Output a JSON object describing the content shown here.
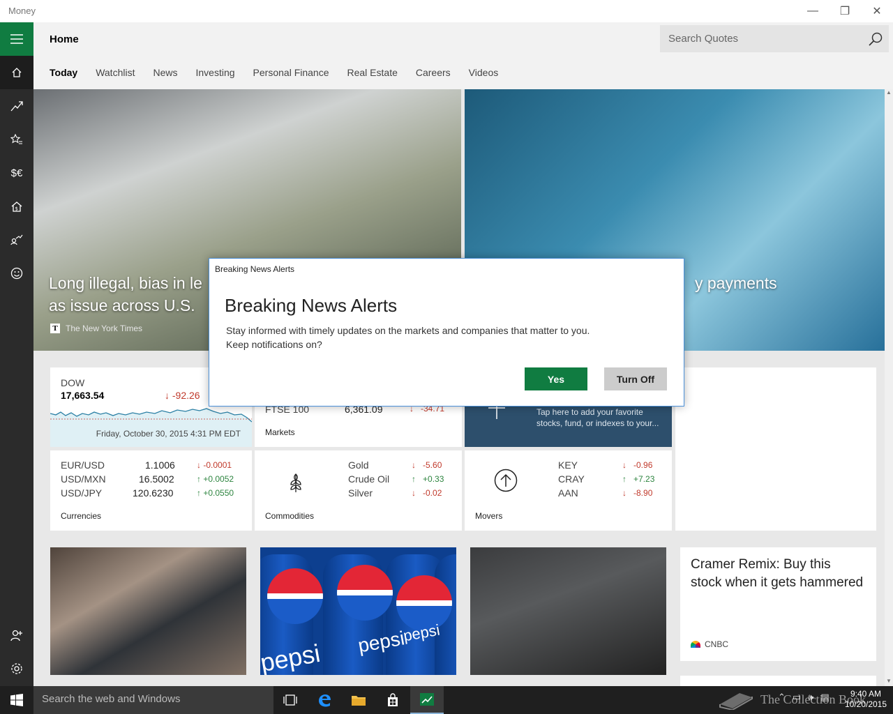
{
  "window": {
    "title": "Money",
    "minimize": "—",
    "maximize": "❐",
    "close": "✕"
  },
  "header": {
    "title": "Home",
    "search_placeholder": "Search Quotes",
    "tabs": [
      "Today",
      "Watchlist",
      "News",
      "Investing",
      "Personal Finance",
      "Real Estate",
      "Careers",
      "Videos"
    ]
  },
  "nav_icons": [
    "hamburger-icon",
    "home-icon",
    "chart-trend-icon",
    "star-list-icon",
    "currency-icon",
    "house-dollar-icon",
    "person-chart-icon",
    "smiley-icon",
    "add-user-icon",
    "settings-icon"
  ],
  "hero": {
    "left": {
      "caption": "Long illegal, bias in lending persists as issue across U.S.",
      "caption_visible_1": "Long illegal, bias in le",
      "caption_visible_2": "as issue across U.S.",
      "source": "The New York Times",
      "source_logo": "T"
    },
    "right": {
      "caption_visible": "y payments"
    }
  },
  "dow": {
    "name": "DOW",
    "value": "17,663.54",
    "change": "-92.26",
    "timestamp": "Friday, October 30, 2015 4:31 PM EDT"
  },
  "markets": {
    "name": "FTSE 100",
    "value": "6,361.09",
    "change": "-34.71",
    "label": "Markets"
  },
  "watchlist": {
    "text": "Tap here to add your favorite stocks, fund, or indexes to your..."
  },
  "currencies": {
    "label": "Currencies",
    "rows": [
      {
        "name": "EUR/USD",
        "value": "1.1006",
        "change": "-0.0001",
        "dir": "down"
      },
      {
        "name": "USD/MXN",
        "value": "16.5002",
        "change": "+0.0052",
        "dir": "up"
      },
      {
        "name": "USD/JPY",
        "value": "120.6230",
        "change": "+0.0550",
        "dir": "up"
      }
    ]
  },
  "commodities": {
    "label": "Commodities",
    "rows": [
      {
        "name": "Gold",
        "change": "-5.60",
        "dir": "down"
      },
      {
        "name": "Crude Oil",
        "change": "+0.33",
        "dir": "up"
      },
      {
        "name": "Silver",
        "change": "-0.02",
        "dir": "down"
      }
    ]
  },
  "movers": {
    "label": "Movers",
    "rows": [
      {
        "name": "KEY",
        "change": "-0.96",
        "dir": "down"
      },
      {
        "name": "CRAY",
        "change": "+7.23",
        "dir": "up"
      },
      {
        "name": "AAN",
        "change": "-8.90",
        "dir": "down"
      }
    ]
  },
  "news_card": {
    "headline": "Cramer Remix: Buy this stock when it gets hammered",
    "source": "CNBC"
  },
  "pepsi_words": [
    "pepsi",
    "pepsi",
    "pepsi"
  ],
  "dialog": {
    "window_title": "Breaking News Alerts",
    "heading": "Breaking News Alerts",
    "body_line1": "Stay informed with timely updates on the markets and companies that matter to you.",
    "body_line2": "Keep notifications on?",
    "yes_label": "Yes",
    "off_label": "Turn Off"
  },
  "taskbar": {
    "search_placeholder": "Search the web and Windows",
    "time": "9:40 AM",
    "date": "10/20/2015",
    "watermark": "The Collection Book"
  },
  "colors": {
    "accent": "#107c41",
    "down": "#c0392b",
    "up": "#2e8540",
    "nav_bg": "#2b2b2b",
    "watch_tile": "#2d4f6c"
  }
}
